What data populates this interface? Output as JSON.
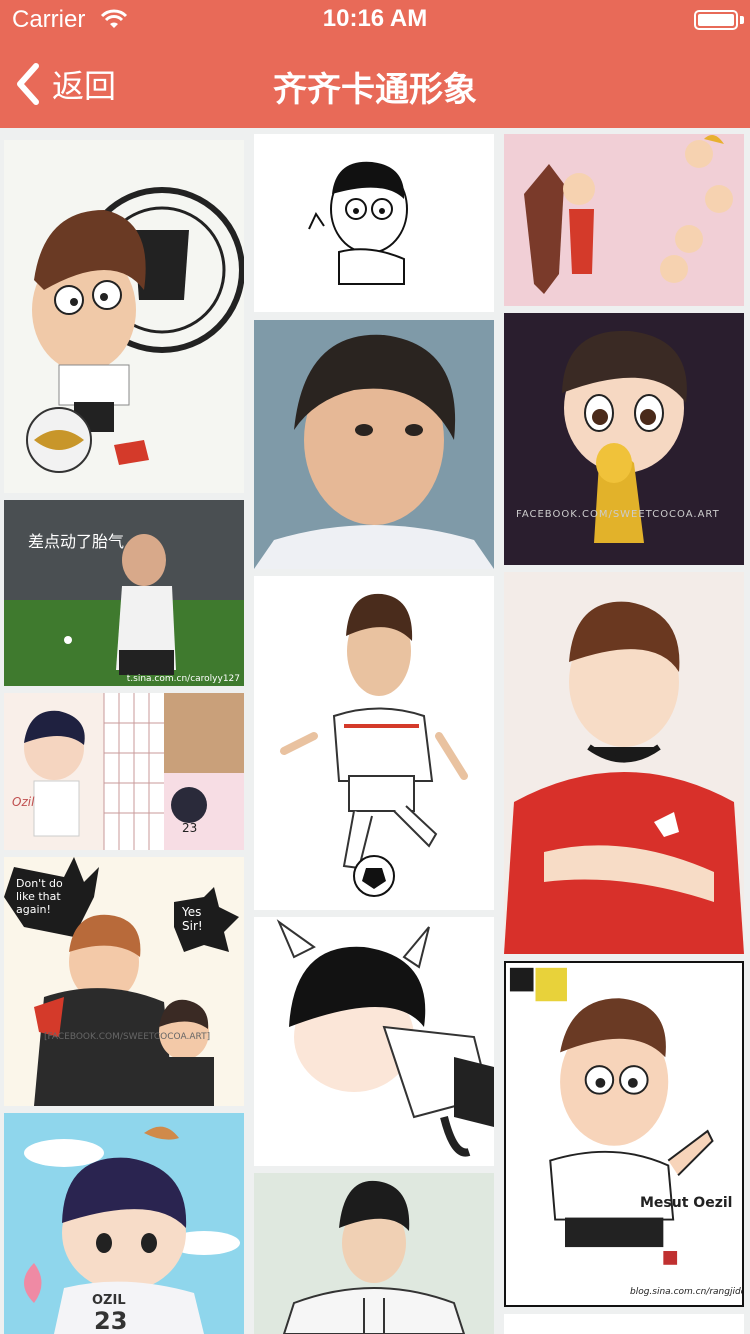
{
  "status_bar": {
    "carrier": "Carrier",
    "time": "10:16 AM"
  },
  "nav": {
    "back_label": "返回",
    "title": "齐齐卡通形象"
  },
  "images": {
    "tile_10_caption": "差点动了胎气",
    "tile_10_source": "t.sina.com.cn/carolyy127",
    "tile_11_name": "Ozil",
    "tile_11_number": "23",
    "tile_12_bubble_1": "Don't do like that again!",
    "tile_12_bubble_2": "Yes Sir!",
    "tile_12_watermark": "[FACEBOOK.COM/SWEETCOCOA.ART]",
    "tile_13_name": "OZIL",
    "tile_13_number": "23",
    "tile_30_watermark": "FACEBOOK.COM/SWEETCOCOA.ART",
    "tile_33_label": "Mesut Oezil",
    "tile_33_source": "blog.sina.com.cn/rangjidong"
  },
  "colors": {
    "header": "#e86a58",
    "background": "#eef0f0"
  }
}
